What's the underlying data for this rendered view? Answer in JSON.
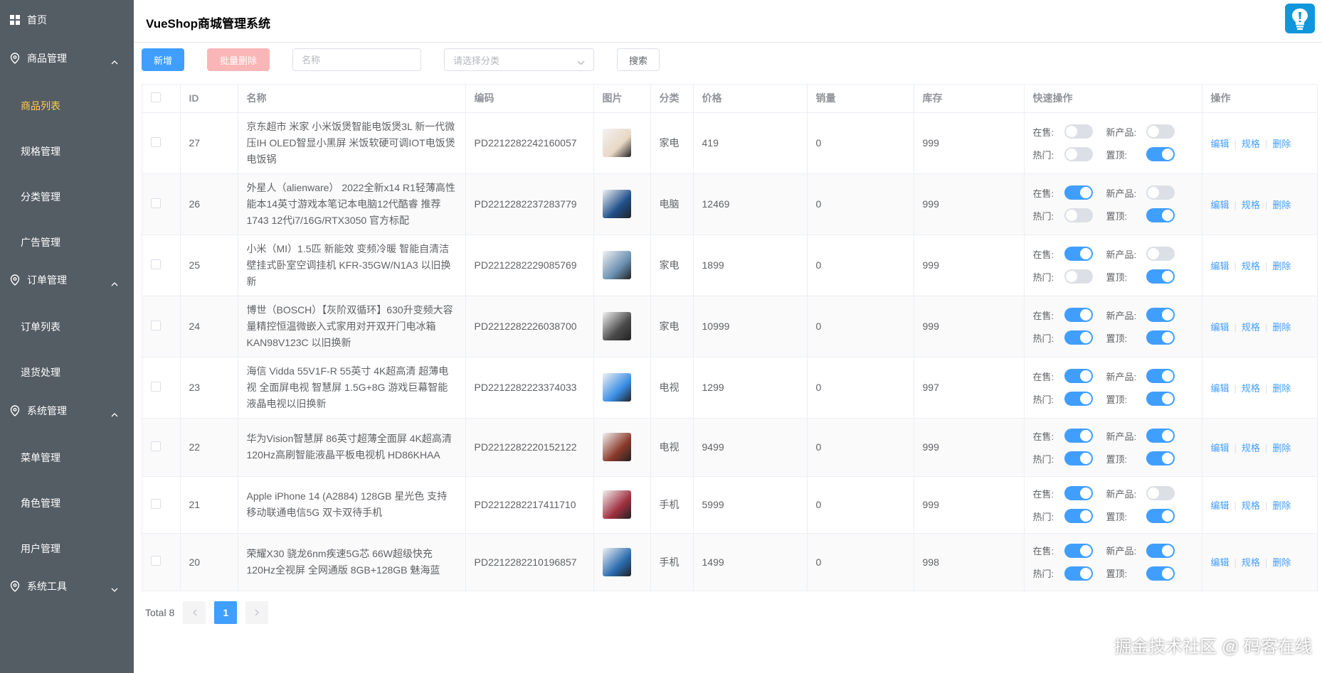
{
  "colors": {
    "sidebar": "#545c64",
    "active_menu": "#ffd04b",
    "primary": "#409eff",
    "danger_disabled": "#fab6b6"
  },
  "sidebar": {
    "home": {
      "label": "首页",
      "icon": "grid-icon"
    },
    "groups": [
      {
        "label": "商品管理",
        "icon": "location-pin-icon",
        "expanded": true,
        "items": [
          "商品列表",
          "规格管理",
          "分类管理",
          "广告管理"
        ]
      },
      {
        "label": "订单管理",
        "icon": "location-pin-icon",
        "expanded": true,
        "items": [
          "订单列表",
          "退货处理"
        ]
      },
      {
        "label": "系统管理",
        "icon": "location-pin-icon",
        "expanded": true,
        "items": [
          "菜单管理",
          "角色管理",
          "用户管理"
        ]
      },
      {
        "label": "系统工具",
        "icon": "location-pin-icon",
        "expanded": false,
        "items": []
      }
    ],
    "active_item": "商品列表"
  },
  "header": {
    "title": "VueShop商城管理系统",
    "logo_icon": "lightbulb-icon"
  },
  "toolbar": {
    "add_label": "新增",
    "batch_delete_label": "批量删除",
    "name_placeholder": "名称",
    "category_placeholder": "请选择分类",
    "search_label": "搜索"
  },
  "table": {
    "columns": [
      "ID",
      "名称",
      "编码",
      "图片",
      "分类",
      "价格",
      "销量",
      "库存",
      "快速操作",
      "操作"
    ],
    "quick_labels": {
      "on_sale": "在售:",
      "new": "新产品:",
      "hot": "热门:",
      "top": "置顶:"
    },
    "op_labels": {
      "edit": "编辑",
      "spec": "规格",
      "delete": "删除"
    },
    "rows": [
      {
        "id": "27",
        "name": "京东超市 米家 小米饭煲智能电饭煲3L 新一代微压IH OLED智显小黑屏 米饭软硬可调IOT电饭煲电饭锅",
        "code": "PD2212282242160057",
        "category": "家电",
        "price": "419",
        "sales": "0",
        "stock": "999",
        "on_sale": false,
        "is_new": false,
        "hot": false,
        "top": true,
        "thumb": "#e8d7c4"
      },
      {
        "id": "26",
        "name": "外星人（alienware） 2022全新x14 R1轻薄高性能本14英寸游戏本笔记本电脑12代酷睿 推荐1743 12代i7/16G/RTX3050 官方标配",
        "code": "PD2212282237283779",
        "category": "电脑",
        "price": "12469",
        "sales": "0",
        "stock": "999",
        "on_sale": true,
        "is_new": false,
        "hot": false,
        "top": true,
        "thumb": "#1f4f8a"
      },
      {
        "id": "25",
        "name": "小米（MI）1.5匹 新能效 变频冷暖 智能自清洁 壁挂式卧室空调挂机 KFR-35GW/N1A3 以旧换新",
        "code": "PD2212282229085769",
        "category": "家电",
        "price": "1899",
        "sales": "0",
        "stock": "999",
        "on_sale": true,
        "is_new": false,
        "hot": false,
        "top": true,
        "thumb": "#6a8fb0"
      },
      {
        "id": "24",
        "name": "博世（BOSCH）【灰阶双循环】630升变频大容量精控恒温微嵌入式家用对开双开门电冰箱KAN98V123C 以旧换新",
        "code": "PD2212282226038700",
        "category": "家电",
        "price": "10999",
        "sales": "0",
        "stock": "999",
        "on_sale": true,
        "is_new": true,
        "hot": true,
        "top": true,
        "thumb": "#4a4a4a"
      },
      {
        "id": "23",
        "name": "海信 Vidda 55V1F-R 55英寸 4K超高清 超薄电视 全面屏电视 智慧屏 1.5G+8G 游戏巨幕智能液晶电视以旧换新",
        "code": "PD2212282223374033",
        "category": "电视",
        "price": "1299",
        "sales": "0",
        "stock": "997",
        "on_sale": true,
        "is_new": true,
        "hot": true,
        "top": true,
        "thumb": "#3a8ee6"
      },
      {
        "id": "22",
        "name": "华为Vision智慧屏 86英寸超薄全面屏 4K超高清120Hz高刷智能液晶平板电视机 HD86KHAA",
        "code": "PD2212282220152122",
        "category": "电视",
        "price": "9499",
        "sales": "0",
        "stock": "999",
        "on_sale": true,
        "is_new": true,
        "hot": true,
        "top": true,
        "thumb": "#8a3a2a"
      },
      {
        "id": "21",
        "name": "Apple iPhone 14 (A2884) 128GB 星光色 支持移动联通电信5G 双卡双待手机",
        "code": "PD2212282217411710",
        "category": "手机",
        "price": "5999",
        "sales": "0",
        "stock": "999",
        "on_sale": true,
        "is_new": false,
        "hot": true,
        "top": true,
        "thumb": "#a03040"
      },
      {
        "id": "20",
        "name": "荣耀X30 骁龙6nm疾速5G芯 66W超级快充 120Hz全视屏 全网通版 8GB+128GB 魅海蓝",
        "code": "PD2212282210196857",
        "category": "手机",
        "price": "1499",
        "sales": "0",
        "stock": "998",
        "on_sale": true,
        "is_new": true,
        "hot": true,
        "top": true,
        "thumb": "#2b6cb0"
      }
    ]
  },
  "pagination": {
    "total_label": "Total 8",
    "current_page": "1",
    "prev_icon": "chevron-left-icon",
    "next_icon": "chevron-right-icon"
  },
  "watermark": "掘金技术社区 @ 码客在线"
}
